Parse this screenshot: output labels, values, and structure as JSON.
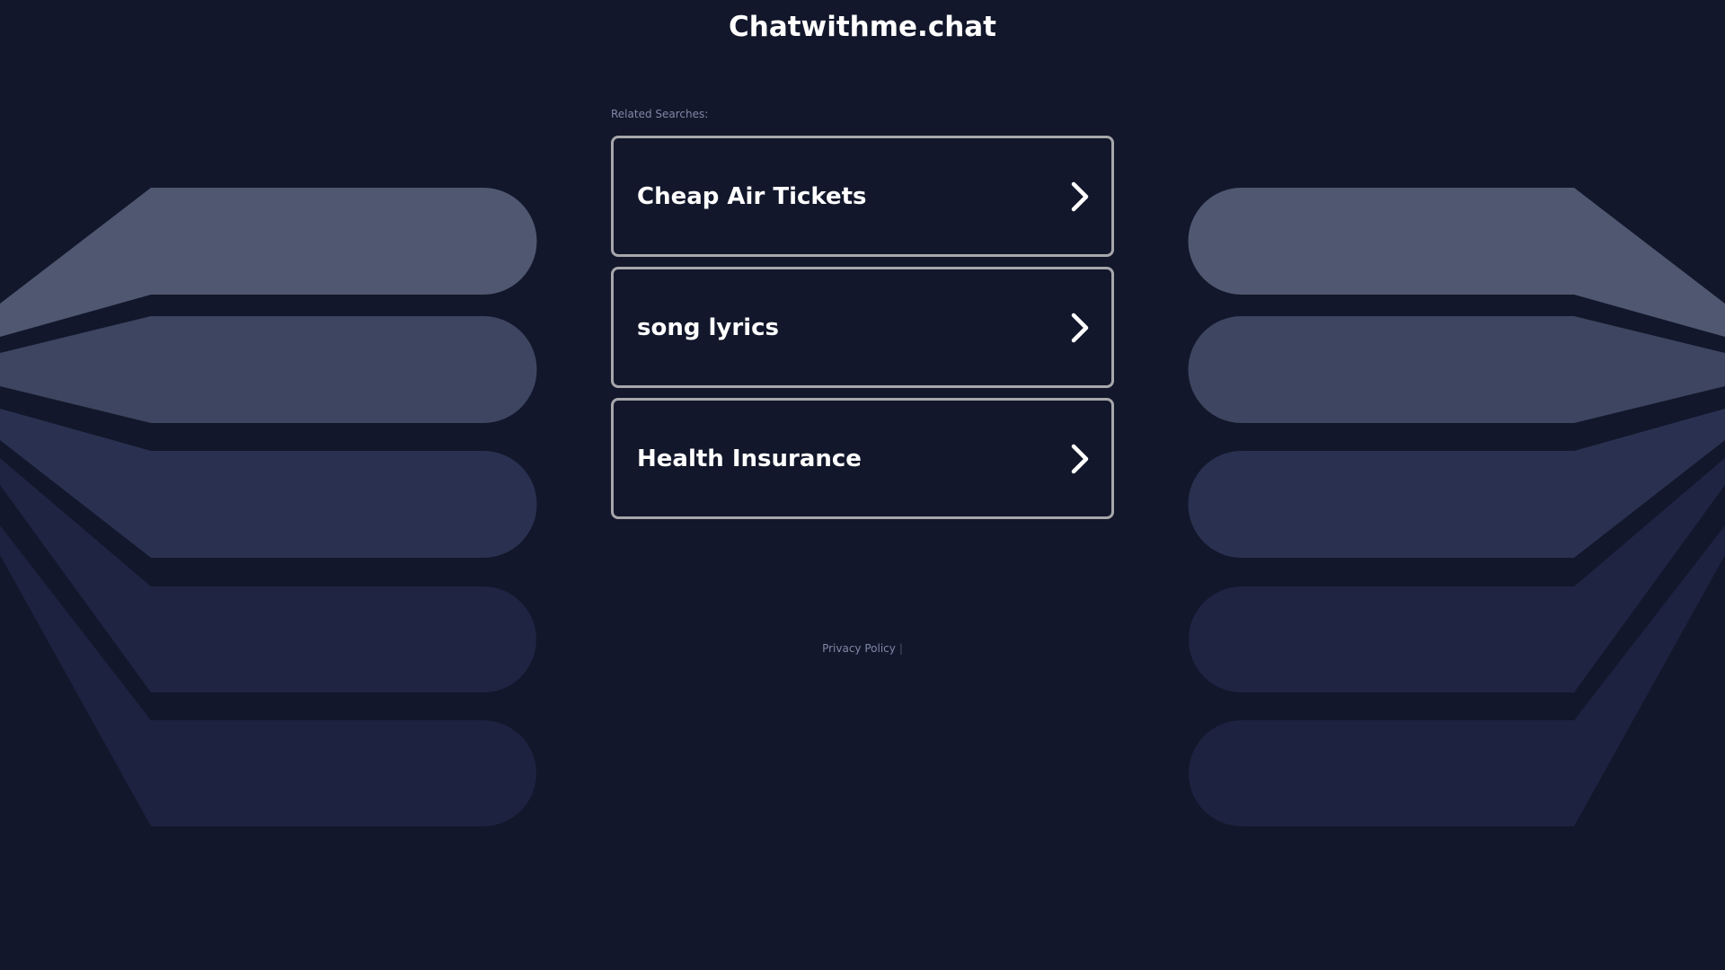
{
  "site": {
    "title": "Chatwithme.chat"
  },
  "related": {
    "label": "Related Searches:",
    "items": [
      {
        "label": "Cheap Air Tickets",
        "icon": "chevron-right-icon"
      },
      {
        "label": "song lyrics",
        "icon": "chevron-right-icon"
      },
      {
        "label": "Health Insurance",
        "icon": "chevron-right-icon"
      }
    ]
  },
  "footer": {
    "privacy_label": "Privacy Policy",
    "separator": "|"
  },
  "colors": {
    "background": "#12172b",
    "card_border": "#a7a7ab",
    "text": "#ffffff",
    "muted_text": "#8088a6",
    "decor_band_1": "#4f5771",
    "decor_band_2": "#3d4560",
    "decor_band_3": "#2a3150",
    "decor_band_4": "#1f2443",
    "decor_band_5": "#1d2240"
  }
}
